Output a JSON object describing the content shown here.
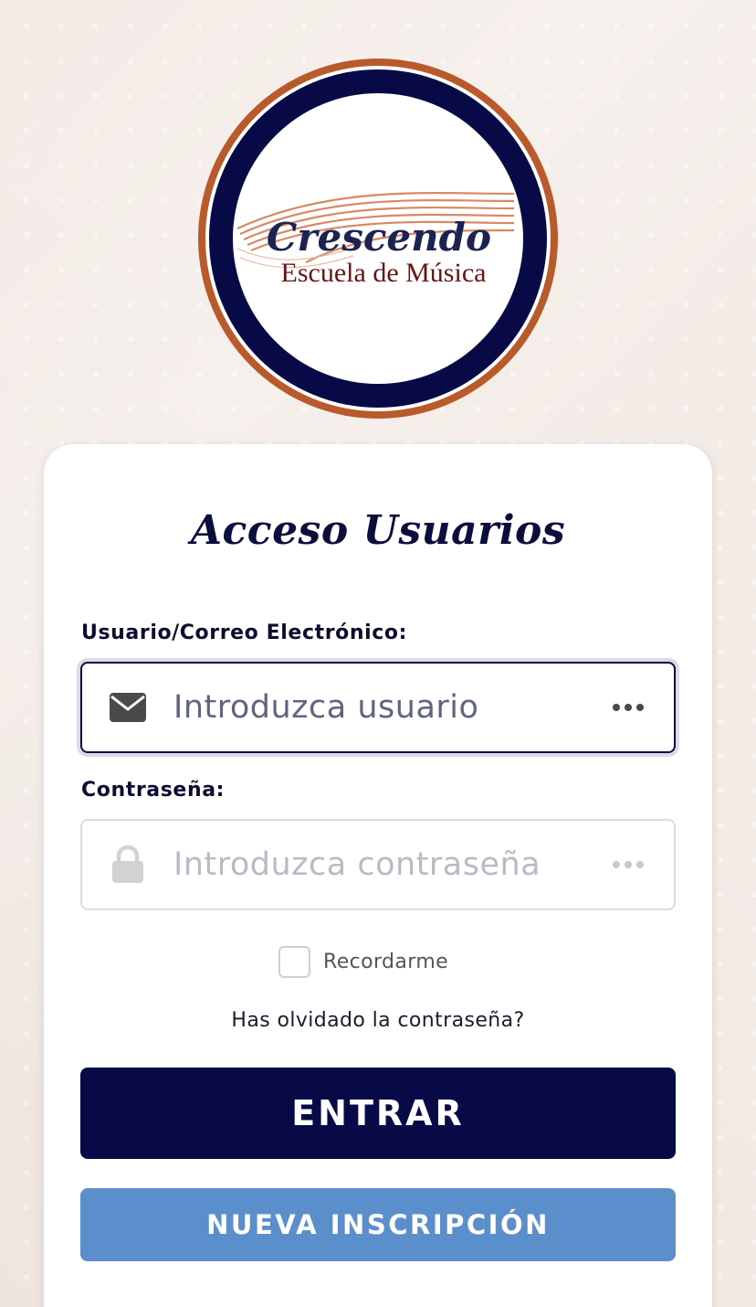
{
  "logo": {
    "title": "Crescendo",
    "subtitle": "Escuela de Música"
  },
  "card": {
    "title": "Acceso Usuarios"
  },
  "username": {
    "label": "Usuario/Correo Electrónico:",
    "placeholder": "Introduzca usuario",
    "icon": "envelope-icon",
    "value": ""
  },
  "password": {
    "label": "Contraseña:",
    "placeholder": "Introduzca contraseña",
    "icon": "lock-icon",
    "value": ""
  },
  "remember": {
    "label": "Recordarme",
    "checked": false
  },
  "forgot_link": "Has olvidado la contraseña?",
  "buttons": {
    "login": "ENTRAR",
    "register": "NUEVA INSCRIPCIÓN"
  },
  "colors": {
    "navy": "#070a47",
    "copper": "#b85a2b",
    "button_secondary": "#5b8fcc",
    "background": "#f3ebe6"
  }
}
